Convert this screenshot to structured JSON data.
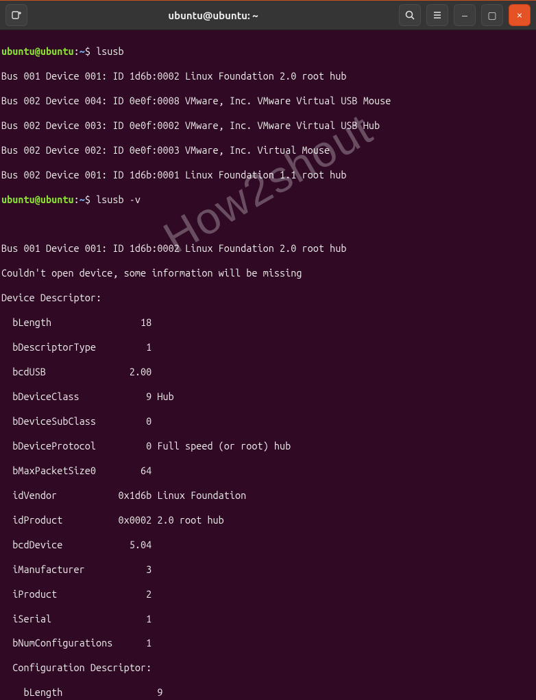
{
  "titlebar": {
    "title": "ubuntu@ubuntu: ~",
    "new_tab_icon": "new-tab-icon",
    "search_icon": "search-icon",
    "menu_icon": "hamburger-icon",
    "minimize_label": "–",
    "maximize_label": "▢",
    "close_label": "×"
  },
  "prompt": {
    "user_host": "ubuntu@ubuntu",
    "path": "~",
    "symbol": "$"
  },
  "commands": {
    "cmd1": "lsusb",
    "cmd2": "lsusb -v"
  },
  "output1": [
    "Bus 001 Device 001: ID 1d6b:0002 Linux Foundation 2.0 root hub",
    "Bus 002 Device 004: ID 0e0f:0008 VMware, Inc. VMware Virtual USB Mouse",
    "Bus 002 Device 003: ID 0e0f:0002 VMware, Inc. VMware Virtual USB Hub",
    "Bus 002 Device 002: ID 0e0f:0003 VMware, Inc. Virtual Mouse",
    "Bus 002 Device 001: ID 1d6b:0001 Linux Foundation 1.1 root hub"
  ],
  "output2": [
    "",
    "Bus 001 Device 001: ID 1d6b:0002 Linux Foundation 2.0 root hub",
    "Couldn't open device, some information will be missing",
    "Device Descriptor:",
    "  bLength                18",
    "  bDescriptorType         1",
    "  bcdUSB               2.00",
    "  bDeviceClass            9 Hub",
    "  bDeviceSubClass         0",
    "  bDeviceProtocol         0 Full speed (or root) hub",
    "  bMaxPacketSize0        64",
    "  idVendor           0x1d6b Linux Foundation",
    "  idProduct          0x0002 2.0 root hub",
    "  bcdDevice            5.04",
    "  iManufacturer           3",
    "  iProduct                2",
    "  iSerial                 1",
    "  bNumConfigurations      1",
    "  Configuration Descriptor:",
    "    bLength                 9"
  ],
  "watermark": "How2shout"
}
